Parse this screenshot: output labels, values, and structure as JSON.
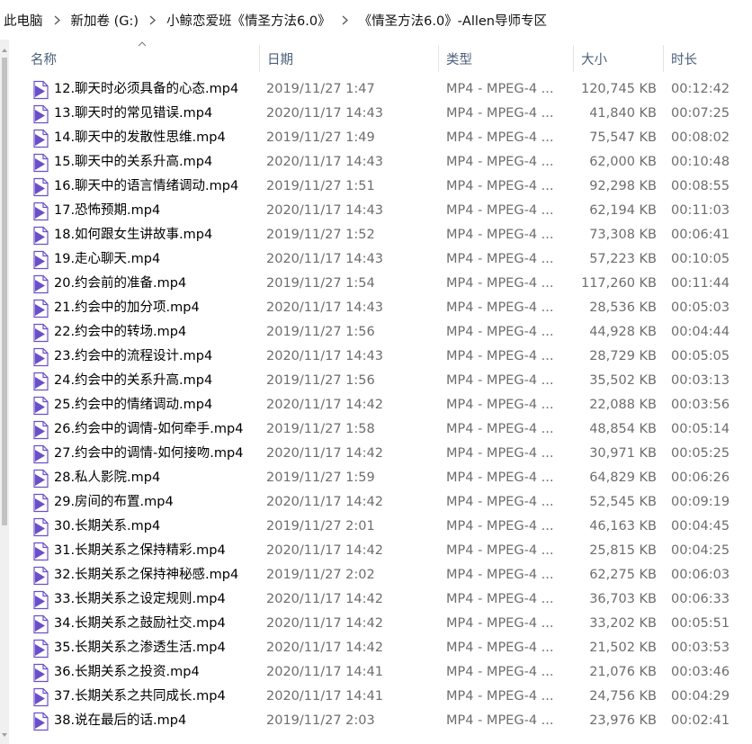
{
  "breadcrumb": {
    "items": [
      "此电脑",
      "新加卷 (G:)",
      "小鲸恋爱班《情圣方法6.0》",
      "《情圣方法6.0》-Allen导师专区"
    ]
  },
  "columns": {
    "name": "名称",
    "date": "日期",
    "type": "类型",
    "size": "大小",
    "duration": "时长"
  },
  "icons": {
    "file": "video-file-icon",
    "separator": "chevron-right-icon",
    "sort": "sort-ascending-icon"
  },
  "colors": {
    "icon": "#6a4fc8",
    "header_text": "#4c607a",
    "meta_text": "#6d6d6d"
  },
  "files": [
    {
      "name": "12.聊天时必须具备的心态.mp4",
      "date": "2019/11/27 1:47",
      "type": "MP4 - MPEG-4 ...",
      "size": "120,745 KB",
      "duration": "00:12:42"
    },
    {
      "name": "13.聊天时的常见错误.mp4",
      "date": "2020/11/17 14:43",
      "type": "MP4 - MPEG-4 ...",
      "size": "41,840 KB",
      "duration": "00:07:25"
    },
    {
      "name": "14.聊天中的发散性思维.mp4",
      "date": "2019/11/27 1:49",
      "type": "MP4 - MPEG-4 ...",
      "size": "75,547 KB",
      "duration": "00:08:02"
    },
    {
      "name": "15.聊天中的关系升高.mp4",
      "date": "2020/11/17 14:43",
      "type": "MP4 - MPEG-4 ...",
      "size": "62,000 KB",
      "duration": "00:10:48"
    },
    {
      "name": "16.聊天中的语言情绪调动.mp4",
      "date": "2019/11/27 1:51",
      "type": "MP4 - MPEG-4 ...",
      "size": "92,298 KB",
      "duration": "00:08:55"
    },
    {
      "name": "17.恐怖预期.mp4",
      "date": "2020/11/17 14:43",
      "type": "MP4 - MPEG-4 ...",
      "size": "62,194 KB",
      "duration": "00:11:03"
    },
    {
      "name": "18.如何跟女生讲故事.mp4",
      "date": "2019/11/27 1:52",
      "type": "MP4 - MPEG-4 ...",
      "size": "73,308 KB",
      "duration": "00:06:41"
    },
    {
      "name": "19.走心聊天.mp4",
      "date": "2020/11/17 14:43",
      "type": "MP4 - MPEG-4 ...",
      "size": "57,223 KB",
      "duration": "00:10:05"
    },
    {
      "name": "20.约会前的准备.mp4",
      "date": "2019/11/27 1:54",
      "type": "MP4 - MPEG-4 ...",
      "size": "117,260 KB",
      "duration": "00:11:44"
    },
    {
      "name": "21.约会中的加分项.mp4",
      "date": "2020/11/17 14:43",
      "type": "MP4 - MPEG-4 ...",
      "size": "28,536 KB",
      "duration": "00:05:03"
    },
    {
      "name": "22.约会中的转场.mp4",
      "date": "2019/11/27 1:56",
      "type": "MP4 - MPEG-4 ...",
      "size": "44,928 KB",
      "duration": "00:04:44"
    },
    {
      "name": "23.约会中的流程设计.mp4",
      "date": "2020/11/17 14:43",
      "type": "MP4 - MPEG-4 ...",
      "size": "28,729 KB",
      "duration": "00:05:05"
    },
    {
      "name": "24.约会中的关系升高.mp4",
      "date": "2019/11/27 1:56",
      "type": "MP4 - MPEG-4 ...",
      "size": "35,502 KB",
      "duration": "00:03:13"
    },
    {
      "name": "25.约会中的情绪调动.mp4",
      "date": "2020/11/17 14:42",
      "type": "MP4 - MPEG-4 ...",
      "size": "22,088 KB",
      "duration": "00:03:56"
    },
    {
      "name": "26.约会中的调情-如何牵手.mp4",
      "date": "2019/11/27 1:58",
      "type": "MP4 - MPEG-4 ...",
      "size": "48,854 KB",
      "duration": "00:05:14"
    },
    {
      "name": "27.约会中的调情-如何接吻.mp4",
      "date": "2020/11/17 14:42",
      "type": "MP4 - MPEG-4 ...",
      "size": "30,971 KB",
      "duration": "00:05:25"
    },
    {
      "name": "28.私人影院.mp4",
      "date": "2019/11/27 1:59",
      "type": "MP4 - MPEG-4 ...",
      "size": "64,829 KB",
      "duration": "00:06:26"
    },
    {
      "name": "29.房间的布置.mp4",
      "date": "2020/11/17 14:42",
      "type": "MP4 - MPEG-4 ...",
      "size": "52,545 KB",
      "duration": "00:09:19"
    },
    {
      "name": "30.长期关系.mp4",
      "date": "2019/11/27 2:01",
      "type": "MP4 - MPEG-4 ...",
      "size": "46,163 KB",
      "duration": "00:04:45"
    },
    {
      "name": "31.长期关系之保持精彩.mp4",
      "date": "2020/11/17 14:42",
      "type": "MP4 - MPEG-4 ...",
      "size": "25,815 KB",
      "duration": "00:04:25"
    },
    {
      "name": "32.长期关系之保持神秘感.mp4",
      "date": "2019/11/27 2:02",
      "type": "MP4 - MPEG-4 ...",
      "size": "62,275 KB",
      "duration": "00:06:03"
    },
    {
      "name": "33.长期关系之设定规则.mp4",
      "date": "2020/11/17 14:42",
      "type": "MP4 - MPEG-4 ...",
      "size": "36,703 KB",
      "duration": "00:06:33"
    },
    {
      "name": "34.长期关系之鼓励社交.mp4",
      "date": "2020/11/17 14:42",
      "type": "MP4 - MPEG-4 ...",
      "size": "33,202 KB",
      "duration": "00:05:51"
    },
    {
      "name": "35.长期关系之渗透生活.mp4",
      "date": "2020/11/17 14:42",
      "type": "MP4 - MPEG-4 ...",
      "size": "21,502 KB",
      "duration": "00:03:53"
    },
    {
      "name": "36.长期关系之投资.mp4",
      "date": "2020/11/17 14:41",
      "type": "MP4 - MPEG-4 ...",
      "size": "21,076 KB",
      "duration": "00:03:46"
    },
    {
      "name": "37.长期关系之共同成长.mp4",
      "date": "2020/11/17 14:41",
      "type": "MP4 - MPEG-4 ...",
      "size": "24,756 KB",
      "duration": "00:04:29"
    },
    {
      "name": "38.说在最后的话.mp4",
      "date": "2019/11/27 2:03",
      "type": "MP4 - MPEG-4 ...",
      "size": "23,976 KB",
      "duration": "00:02:41"
    }
  ]
}
